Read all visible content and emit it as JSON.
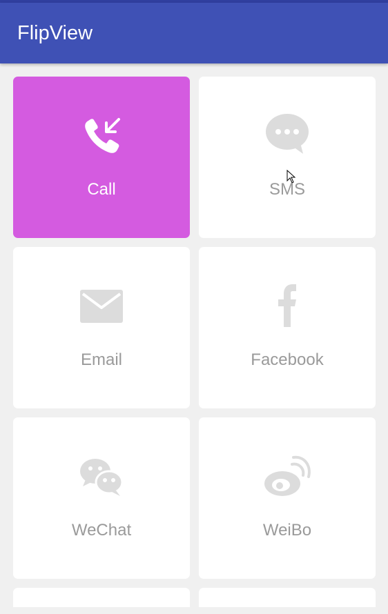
{
  "app": {
    "title": "FlipView"
  },
  "colors": {
    "app_bar": "#3f51b5",
    "status_bar": "#303f9f",
    "active_card": "#d45be0",
    "card_bg": "#ffffff",
    "icon_gray": "#dcdcdc",
    "label_gray": "#9a9a9a"
  },
  "cards": [
    {
      "label": "Call",
      "icon": "phone-incoming-icon",
      "active": true
    },
    {
      "label": "SMS",
      "icon": "chat-bubble-icon",
      "active": false
    },
    {
      "label": "Email",
      "icon": "envelope-icon",
      "active": false
    },
    {
      "label": "Facebook",
      "icon": "facebook-icon",
      "active": false
    },
    {
      "label": "WeChat",
      "icon": "wechat-icon",
      "active": false
    },
    {
      "label": "WeiBo",
      "icon": "weibo-icon",
      "active": false
    }
  ]
}
